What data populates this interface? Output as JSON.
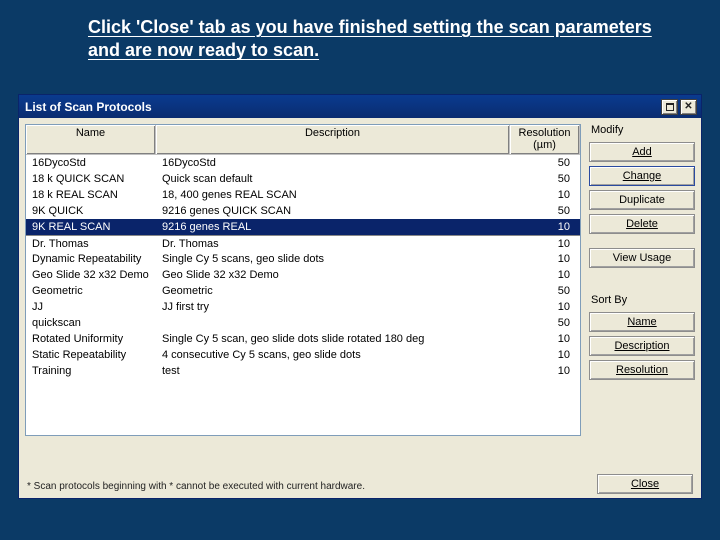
{
  "instruction": "Click 'Close' tab as you have finished setting the scan parameters and are now ready to scan.",
  "window": {
    "title": "List of Scan Protocols",
    "columns": {
      "name": "Name",
      "description": "Description",
      "resolution": "Resolution\n(µm)"
    },
    "rows": [
      {
        "name": "16DycoStd",
        "description": "16DycoStd",
        "resolution": "50",
        "selected": false,
        "divider": false
      },
      {
        "name": "18 k QUICK SCAN",
        "description": "Quick scan default",
        "resolution": "50",
        "selected": false,
        "divider": false
      },
      {
        "name": "18 k REAL SCAN",
        "description": "18, 400 genes REAL SCAN",
        "resolution": "10",
        "selected": false,
        "divider": false
      },
      {
        "name": "9K QUICK",
        "description": "9216 genes QUICK SCAN",
        "resolution": "50",
        "selected": false,
        "divider": false
      },
      {
        "name": "9K REAL SCAN",
        "description": "9216 genes REAL",
        "resolution": "10",
        "selected": true,
        "divider": false
      },
      {
        "name": "Dr. Thomas",
        "description": "Dr. Thomas",
        "resolution": "10",
        "selected": false,
        "divider": true
      },
      {
        "name": "Dynamic Repeatability",
        "description": "Single Cy 5 scans, geo slide dots",
        "resolution": "10",
        "selected": false,
        "divider": false
      },
      {
        "name": "Geo Slide 32 x32 Demo",
        "description": "Geo Slide 32 x32 Demo",
        "resolution": "10",
        "selected": false,
        "divider": false
      },
      {
        "name": "Geometric",
        "description": "Geometric",
        "resolution": "50",
        "selected": false,
        "divider": false
      },
      {
        "name": "JJ",
        "description": "JJ first try",
        "resolution": "10",
        "selected": false,
        "divider": false
      },
      {
        "name": "quickscan",
        "description": "",
        "resolution": "50",
        "selected": false,
        "divider": false
      },
      {
        "name": "Rotated Uniformity",
        "description": "Single Cy 5 scan, geo slide dots  slide rotated 180 deg",
        "resolution": "10",
        "selected": false,
        "divider": false
      },
      {
        "name": "Static Repeatability",
        "description": "4 consecutive Cy 5 scans, geo slide dots",
        "resolution": "10",
        "selected": false,
        "divider": false
      },
      {
        "name": "Training",
        "description": "test",
        "resolution": "10",
        "selected": false,
        "divider": false
      }
    ],
    "modify": {
      "label": "Modify",
      "buttons": {
        "add": "Add",
        "change": "Change",
        "duplicate": "Duplicate",
        "delete": "Delete",
        "view_usage": "View Usage"
      }
    },
    "sort_by": {
      "label": "Sort By",
      "buttons": {
        "name": "Name",
        "description": "Description",
        "resolution": "Resolution"
      }
    },
    "footnote": "* Scan protocols beginning with * cannot be executed with current hardware.",
    "close_label": "Close"
  }
}
